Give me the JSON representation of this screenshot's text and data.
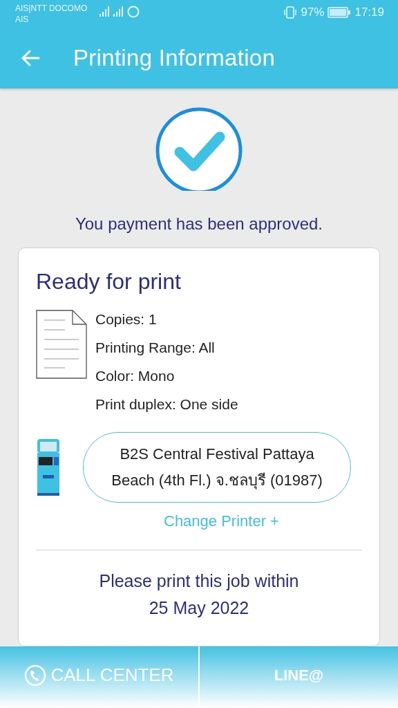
{
  "status_bar": {
    "carrier_lines": [
      "AIS|NTT DOCOMO",
      "AIS"
    ],
    "battery": "97%",
    "time": "17:19"
  },
  "header": {
    "title": "Printing Information"
  },
  "message": "You payment has been approved.",
  "card": {
    "title": "Ready for print",
    "details": [
      "Copies: 1",
      "Printing Range: All",
      "Color: Mono",
      "Print duplex: One side"
    ],
    "printer": "B2S Central Festival Pattaya Beach (4th Fl.) จ.ชลบุรี (01987)",
    "change_printer": "Change Printer +",
    "deadline": [
      "Please print this job within",
      "25 May 2022"
    ]
  },
  "bottom_bar": [
    {
      "kind": "call",
      "label": "CALL CENTER"
    },
    {
      "kind": "line",
      "label": "LINE@"
    }
  ]
}
